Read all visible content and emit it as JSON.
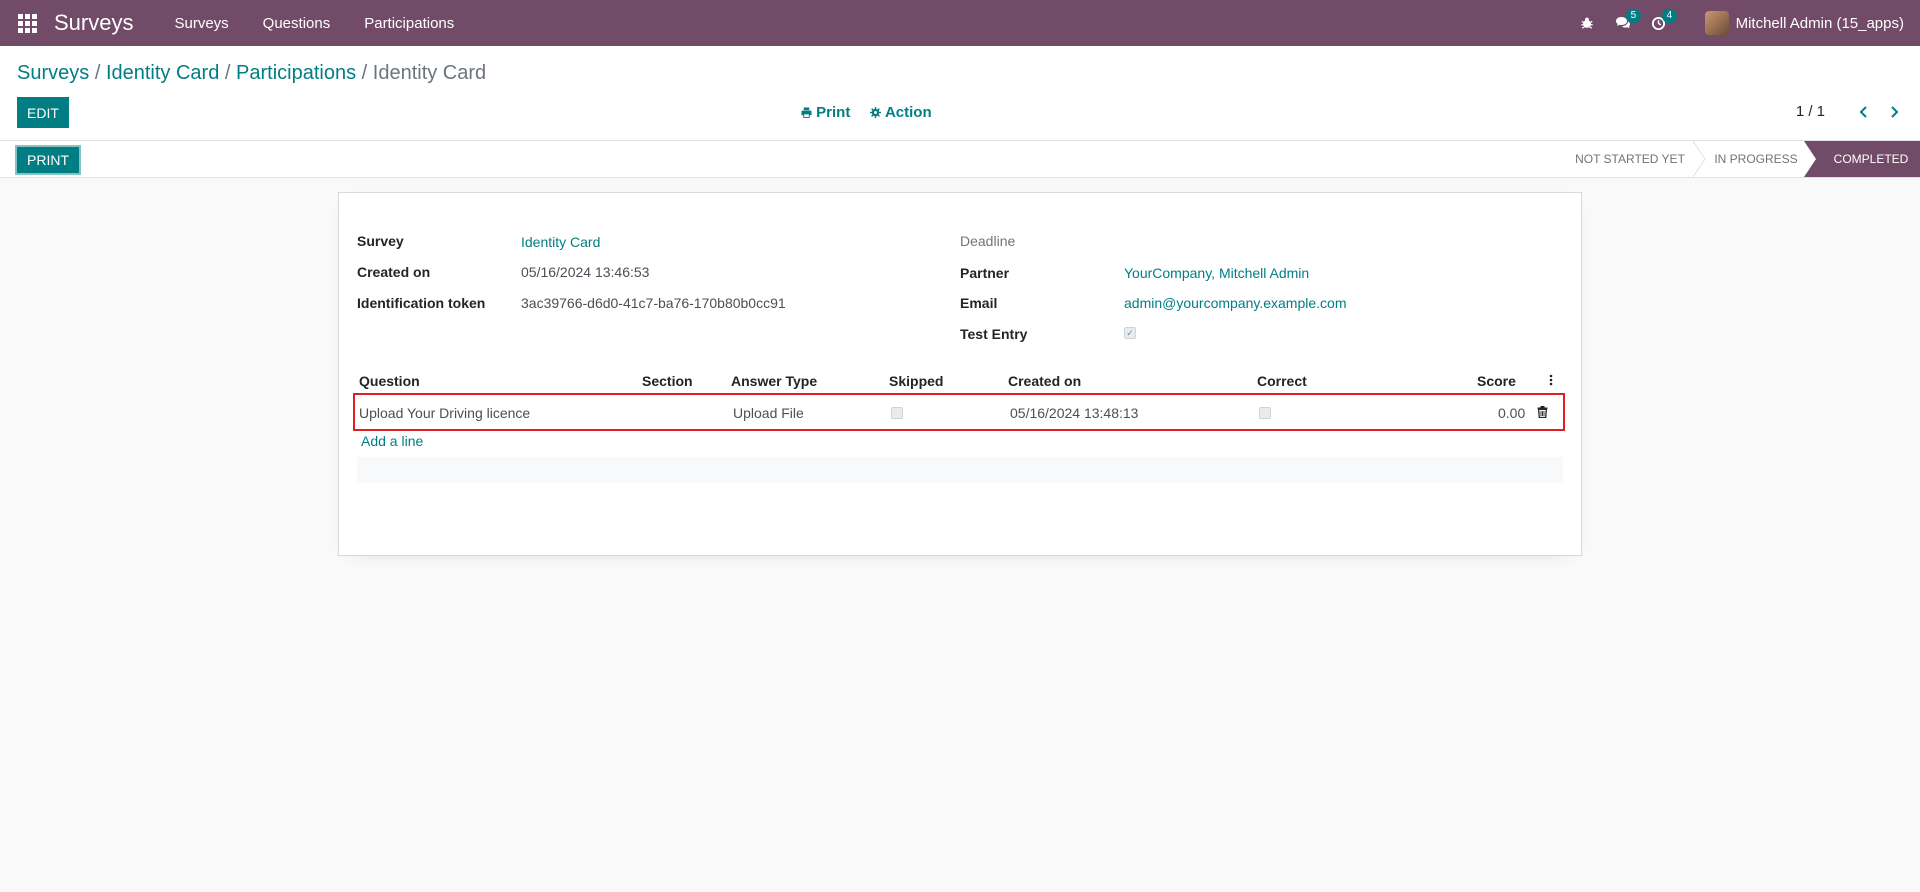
{
  "navbar": {
    "brand": "Surveys",
    "menu": [
      "Surveys",
      "Questions",
      "Participations"
    ],
    "messages_badge": "5",
    "activities_badge": "4",
    "user_name": "Mitchell Admin (15_apps)"
  },
  "breadcrumb": {
    "items": [
      "Surveys",
      "Identity Card",
      "Participations"
    ],
    "separator": "/",
    "current": "Identity Card"
  },
  "toolbar": {
    "edit_label": "EDIT",
    "print_label": "Print",
    "action_label": "Action",
    "pager_value": "1 / 1"
  },
  "statusbar": {
    "print_button": "PRINT",
    "stages": [
      "NOT STARTED YET",
      "IN PROGRESS",
      "COMPLETED"
    ],
    "current_stage": "COMPLETED"
  },
  "form": {
    "survey_label": "Survey",
    "survey_value": "Identity Card",
    "created_on_label": "Created on",
    "created_on_value": "05/16/2024 13:46:53",
    "token_label": "Identification token",
    "token_value": "3ac39766-d6d0-41c7-ba76-170b80b0cc91",
    "deadline_label": "Deadline",
    "partner_label": "Partner",
    "partner_value": "YourCompany, Mitchell Admin",
    "email_label": "Email",
    "email_value": "admin@yourcompany.example.com",
    "test_entry_label": "Test Entry",
    "test_entry_checked": true
  },
  "answers": {
    "columns": [
      "Question",
      "Section",
      "Answer Type",
      "Skipped",
      "Created on",
      "Correct",
      "Score"
    ],
    "rows": [
      {
        "question": "Upload Your Driving licence",
        "section": "",
        "answer_type": "Upload File",
        "skipped": false,
        "created_on": "05/16/2024 13:48:13",
        "correct": false,
        "score": "0.00"
      }
    ],
    "add_line": "Add a line"
  },
  "colors": {
    "brand": "#714b67",
    "accent": "#017e84",
    "highlight": "#e31d24"
  }
}
